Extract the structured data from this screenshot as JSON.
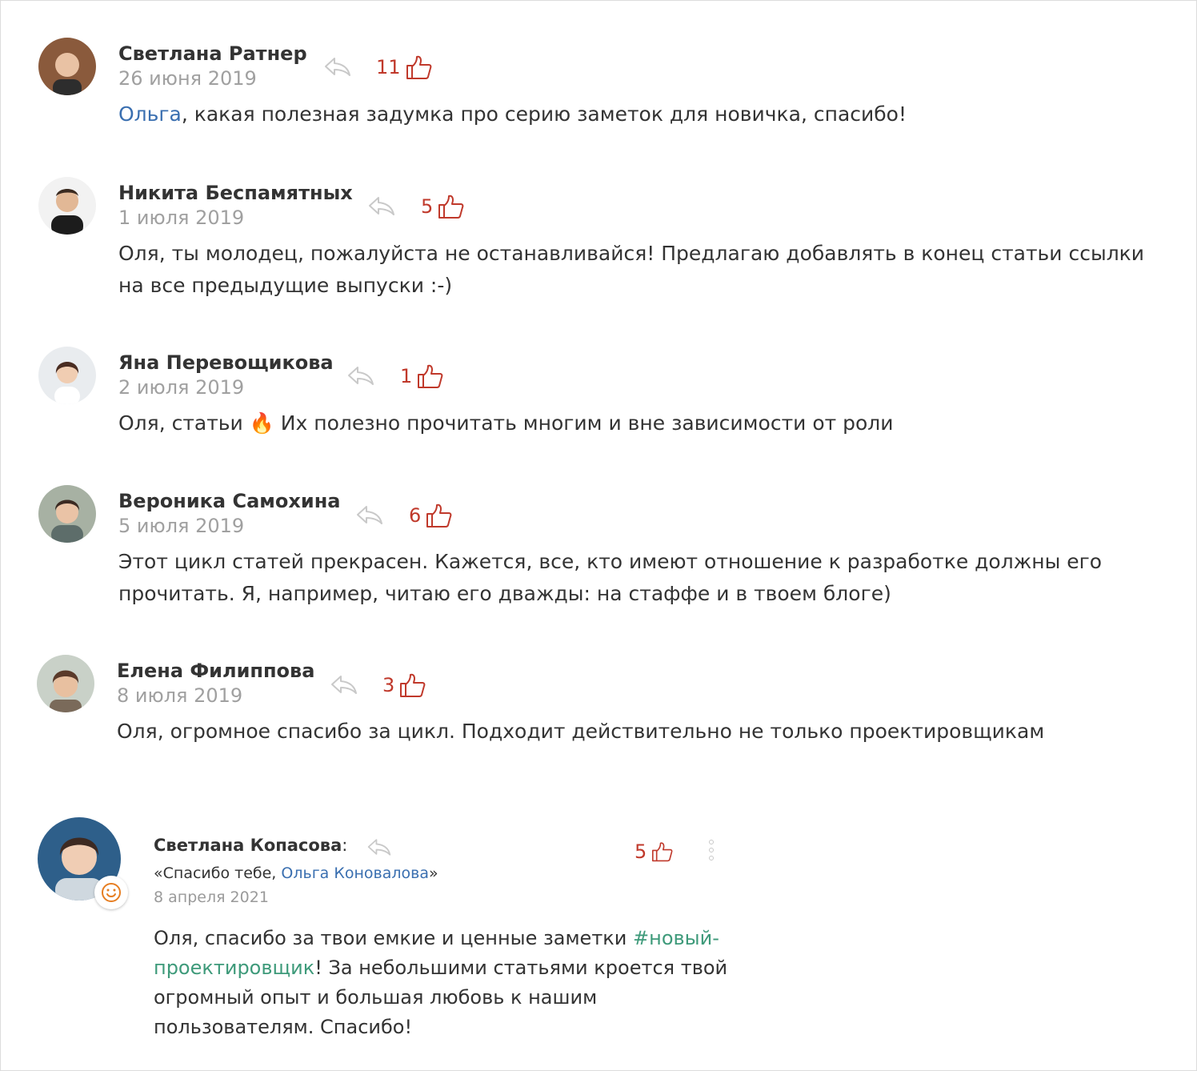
{
  "comments": [
    {
      "author": "Светлана Ратнер",
      "date": "26 июня 2019",
      "likes": "11",
      "text_prefix_link": "Ольга",
      "text": ", какая полезная задумка про серию заметок для новичка, спасибо!"
    },
    {
      "author": "Никита Беспамятных",
      "date": "1 июля 2019",
      "likes": "5",
      "text": "Оля, ты молодец, пожалуйста не останавливайся! Предлагаю добавлять в конец статьи ссылки на все предыдущие выпуски :-)"
    },
    {
      "author": "Яна Перевощикова",
      "date": "2 июля 2019",
      "likes": "1",
      "text_before": "Оля, статьи ",
      "emoji": "🔥",
      "text_after": " Их полезно прочитать многим и вне зависимости от роли"
    },
    {
      "author": "Вероника Самохина",
      "date": "5 июля 2019",
      "likes": "6",
      "text": "Этот цикл статей прекрасен. Кажется, все, кто имеют отношение к разработке должны его прочитать. Я, например, читаю его дважды: на стаффе и в твоем блоге)"
    },
    {
      "author": "Елена Филиппова",
      "date": "8 июля 2019",
      "likes": "3",
      "text": "Оля, огромное спасибо за цикл. Подходит действительно не только проектировщикам"
    }
  ],
  "card": {
    "author": "Светлана Копасова",
    "colon": ":",
    "quote_open": "«Спасибо тебе, ",
    "quote_link": "Ольга Коновалова",
    "quote_close": "»",
    "date": "8 апреля 2021",
    "likes": "5",
    "text_before": "Оля, спасибо за твои емкие и ценные заметки ",
    "hashtag": "#новый-проектировщик",
    "text_after": "! За небольшими статьями кроется твой огромный опыт и большая любовь к нашим пользователям. Спасибо!"
  },
  "icons": {
    "reply": "reply-arrow-icon",
    "like": "thumbs-up-icon",
    "more": "kebab-menu-icon",
    "smile": "smile-icon"
  },
  "colors": {
    "likes": "#c0392b",
    "link": "#3a6fb0",
    "hashtag": "#3e9a7a",
    "date": "#a0a0a0"
  }
}
